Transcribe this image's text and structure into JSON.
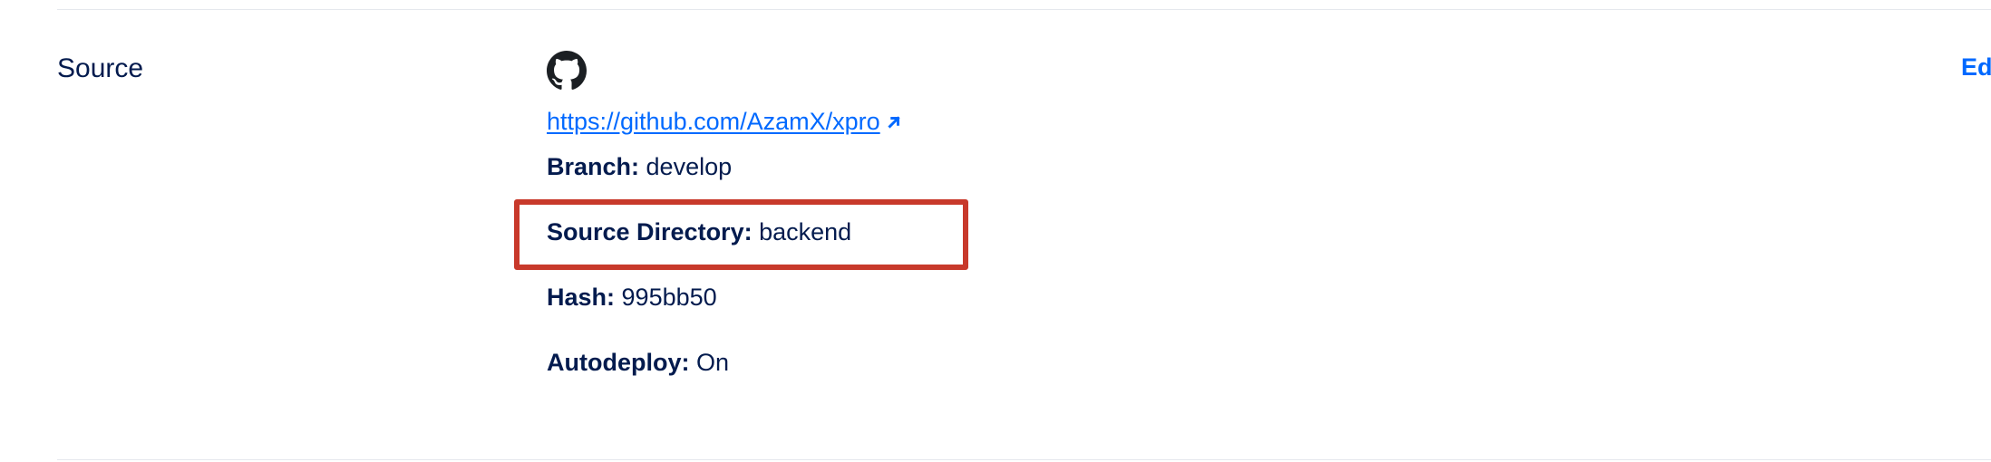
{
  "section": {
    "title": "Source",
    "edit_label": "Ed"
  },
  "source": {
    "provider_icon": "github-icon",
    "repo_url": "https://github.com/AzamX/xpro",
    "link_icon": "external-link-arrow-icon",
    "branch_label": "Branch:",
    "branch_value": "develop",
    "directory_label": "Source Directory:",
    "directory_value": "backend",
    "hash_label": "Hash:",
    "hash_value": "995bb50",
    "autodeploy_label": "Autodeploy:",
    "autodeploy_value": "On"
  },
  "colors": {
    "text": "#031b4e",
    "link": "#0069ff",
    "highlight": "#c8392b",
    "divider": "#e5e8ed"
  }
}
